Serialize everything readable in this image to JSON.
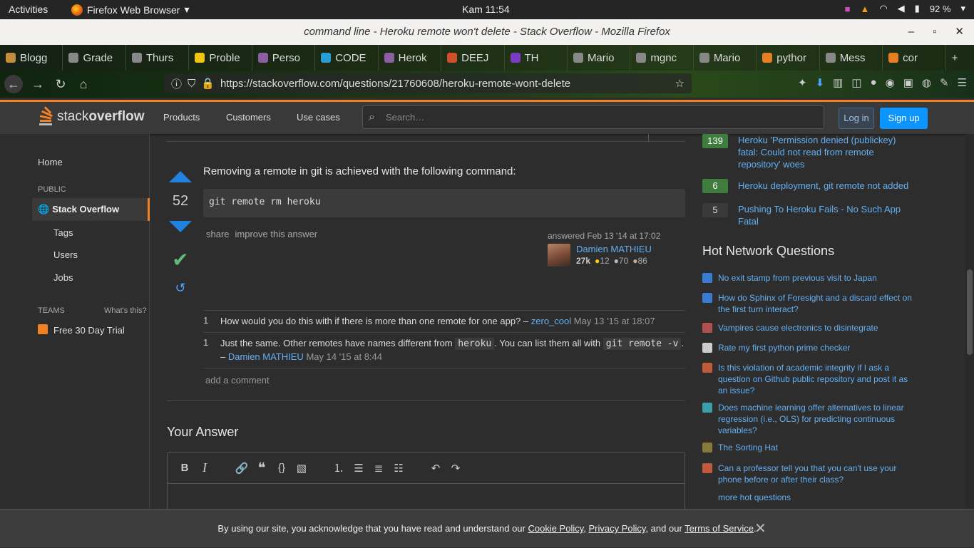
{
  "system": {
    "activities": "Activities",
    "app_name": "Firefox Web Browser",
    "clock": "Kam 11:54",
    "battery": "92 %"
  },
  "window": {
    "title": "command line - Heroku remote won't delete - Stack Overflow - Mozilla Firefox"
  },
  "tabs": [
    {
      "label": "Blogg",
      "color": "#c48d3b"
    },
    {
      "label": "Grade",
      "color": "#888888"
    },
    {
      "label": "Thurs",
      "color": "#888888"
    },
    {
      "label": "Proble",
      "color": "#f1c40f"
    },
    {
      "label": "Perso",
      "color": "#8e5ea2"
    },
    {
      "label": "CODE",
      "color": "#2a9fd6"
    },
    {
      "label": "Herok",
      "color": "#8e5ea2"
    },
    {
      "label": "DEEJ",
      "color": "#d04e2a"
    },
    {
      "label": "TH",
      "color": "#7a3cc2"
    },
    {
      "label": "Mario",
      "color": "#888888"
    },
    {
      "label": "mgnc",
      "color": "#888888"
    },
    {
      "label": "Mario",
      "color": "#888888"
    },
    {
      "label": "pythor",
      "color": "#e67e22"
    },
    {
      "label": "Mess",
      "color": "#888888"
    },
    {
      "label": "cor",
      "color": "#e67e22"
    }
  ],
  "nav": {
    "url": "https://stackoverflow.com/questions/21760608/heroku-remote-wont-delete"
  },
  "so_header": {
    "logo_light": "stack",
    "logo_bold": "overflow",
    "products": "Products",
    "customers": "Customers",
    "use_cases": "Use cases",
    "search_placeholder": "Search…",
    "login": "Log in",
    "signup": "Sign up"
  },
  "leftnav": {
    "home": "Home",
    "public": "PUBLIC",
    "stack_overflow": "Stack Overflow",
    "tags": "Tags",
    "users": "Users",
    "jobs": "Jobs",
    "teams": "TEAMS",
    "whats_this": "What's this?",
    "free_trial": "Free 30 Day Trial"
  },
  "answer": {
    "score": "52",
    "text": "Removing a remote in git is achieved with the following command:",
    "code": "git remote rm heroku",
    "share": "share",
    "improve": "improve this answer",
    "answered": "answered Feb 13 '14 at 17:02",
    "user": "Damien MATHIEU",
    "rep": "27k",
    "gold": "12",
    "silver": "70",
    "bronze": "86"
  },
  "comments": [
    {
      "score": "1",
      "text": "How would you do this with if there is more than one remote for one app? –",
      "user": "zero_cool",
      "date": "May 13 '15 at 18:07"
    },
    {
      "score": "1",
      "text_a": "Just the same. Other remotes have names different from",
      "code_a": "heroku",
      "text_b": ". You can list them all with",
      "code_b": "git remote -v",
      "text_c": ". –",
      "user": "Damien MATHIEU",
      "date": "May 14 '15 at 8:44"
    }
  ],
  "add_comment": "add a comment",
  "your_answer": "Your Answer",
  "related": [
    {
      "count": "139",
      "answered": true,
      "title": "Heroku 'Permission denied (publickey) fatal: Could not read from remote repository' woes"
    },
    {
      "count": "6",
      "answered": true,
      "title": "Heroku deployment, git remote not added"
    },
    {
      "count": "5",
      "answered": false,
      "title": "Pushing To Heroku Fails - No Such App Fatal"
    }
  ],
  "hot_network": {
    "title": "Hot Network Questions",
    "items": [
      {
        "title": "No exit stamp from previous visit to Japan",
        "site_color": "#3a7bd5"
      },
      {
        "title": "How do Sphinx of Foresight and a discard effect on the first turn interact?",
        "site_color": "#3a7bd5"
      },
      {
        "title": "Vampires cause electronics to disintegrate",
        "site_color": "#b05050"
      },
      {
        "title": "Rate my first python prime checker",
        "site_color": "#cccccc"
      },
      {
        "title": "Is this violation of academic integrity if I ask a question on Github public repository and post it as an issue?",
        "site_color": "#c05a3a"
      },
      {
        "title": "Does machine learning offer alternatives to linear regression (i.e., OLS) for predicting continuous variables?",
        "site_color": "#3a9fa6"
      },
      {
        "title": "The Sorting Hat",
        "site_color": "#8a7a3a"
      },
      {
        "title": "Can a professor tell you that you can't use your phone before or after their class?",
        "site_color": "#c05a3a"
      }
    ],
    "more": "more hot questions"
  },
  "cookie": {
    "text1": "By using our site, you acknowledge that you have read and understand our ",
    "cookie_policy": "Cookie Policy",
    "sep1": ", ",
    "privacy_policy": "Privacy Policy",
    "sep2": ", and our ",
    "terms": "Terms of Service",
    "end": "."
  }
}
